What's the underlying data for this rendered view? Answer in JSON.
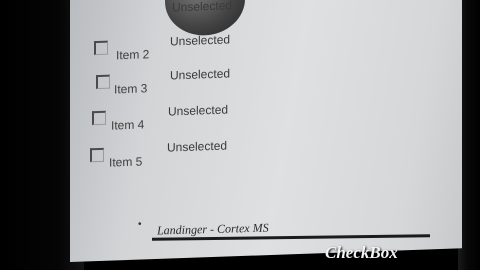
{
  "list": {
    "items": [
      {
        "label": "",
        "state": "Unselected"
      },
      {
        "label": "Item 2",
        "state": "Unselected"
      },
      {
        "label": "Item 3",
        "state": "Unselected"
      },
      {
        "label": "Item 4",
        "state": "Unselected"
      },
      {
        "label": "Item 5",
        "state": "Unselected"
      }
    ]
  },
  "footer": {
    "marker": "•",
    "text": "Landinger - Cortex MS"
  },
  "caption": "CheckBox",
  "colors": {
    "screen": "#dcdddf",
    "text": "#3e3e3e",
    "caption": "#f4f4f4"
  }
}
